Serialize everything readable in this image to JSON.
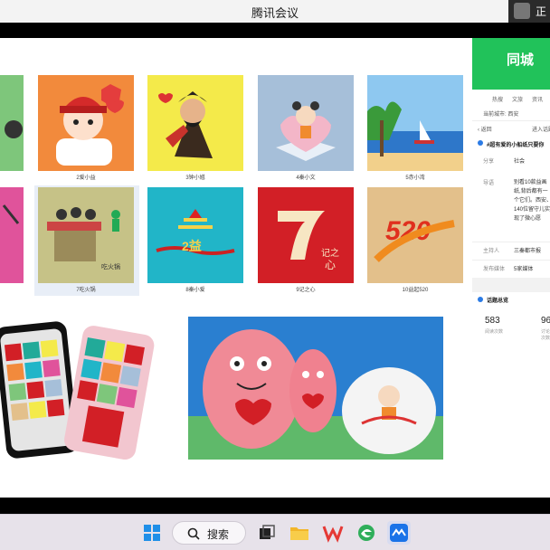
{
  "window": {
    "title": "腾讯会议",
    "user_label": "正"
  },
  "gallery": {
    "row1": [
      {
        "caption": ""
      },
      {
        "caption": "2爱小益",
        "badge": "爱小益"
      },
      {
        "caption": "3钟小馗",
        "badge": "钟小馗"
      },
      {
        "caption": "4秦小文",
        "badge": "秦小文"
      },
      {
        "caption": "5赤小湾",
        "badge": ""
      }
    ],
    "row2": [
      {
        "caption": ""
      },
      {
        "caption": "7吃火锅",
        "badge": "吃火锅"
      },
      {
        "caption": "8秦小爱",
        "badge": ""
      },
      {
        "caption": "9记之心",
        "badge": "记之心"
      },
      {
        "caption": "10益起520",
        "badge": "520"
      }
    ]
  },
  "side_panel": {
    "banner_text": "同城",
    "tabs": [
      "热搜",
      "文旅",
      "资讯"
    ],
    "city": "当前城市: 西安",
    "back": "返回",
    "goto": "进入话题",
    "topic_title": "#超有爱的小船纸只要你",
    "section_label": "分享",
    "section_value": "社会",
    "intro_label": "导语",
    "intro_text": "别看10款益画纸,背后都有一个它们。西安、140位留守儿实现了微心愿",
    "host_label": "主持人",
    "host_value": "三秦都市报",
    "pub_label": "发布媒体",
    "pub_value": "5家媒体",
    "overview": "话题总览",
    "stat1_value": "583",
    "stat1_label": "阅读次数",
    "stat2_value": "96",
    "stat2_label": "讨论次数"
  },
  "taskbar": {
    "search_label": "搜索"
  },
  "colors": {
    "panel_green": "#21c25a",
    "taskbar": "#e7e2ea"
  }
}
